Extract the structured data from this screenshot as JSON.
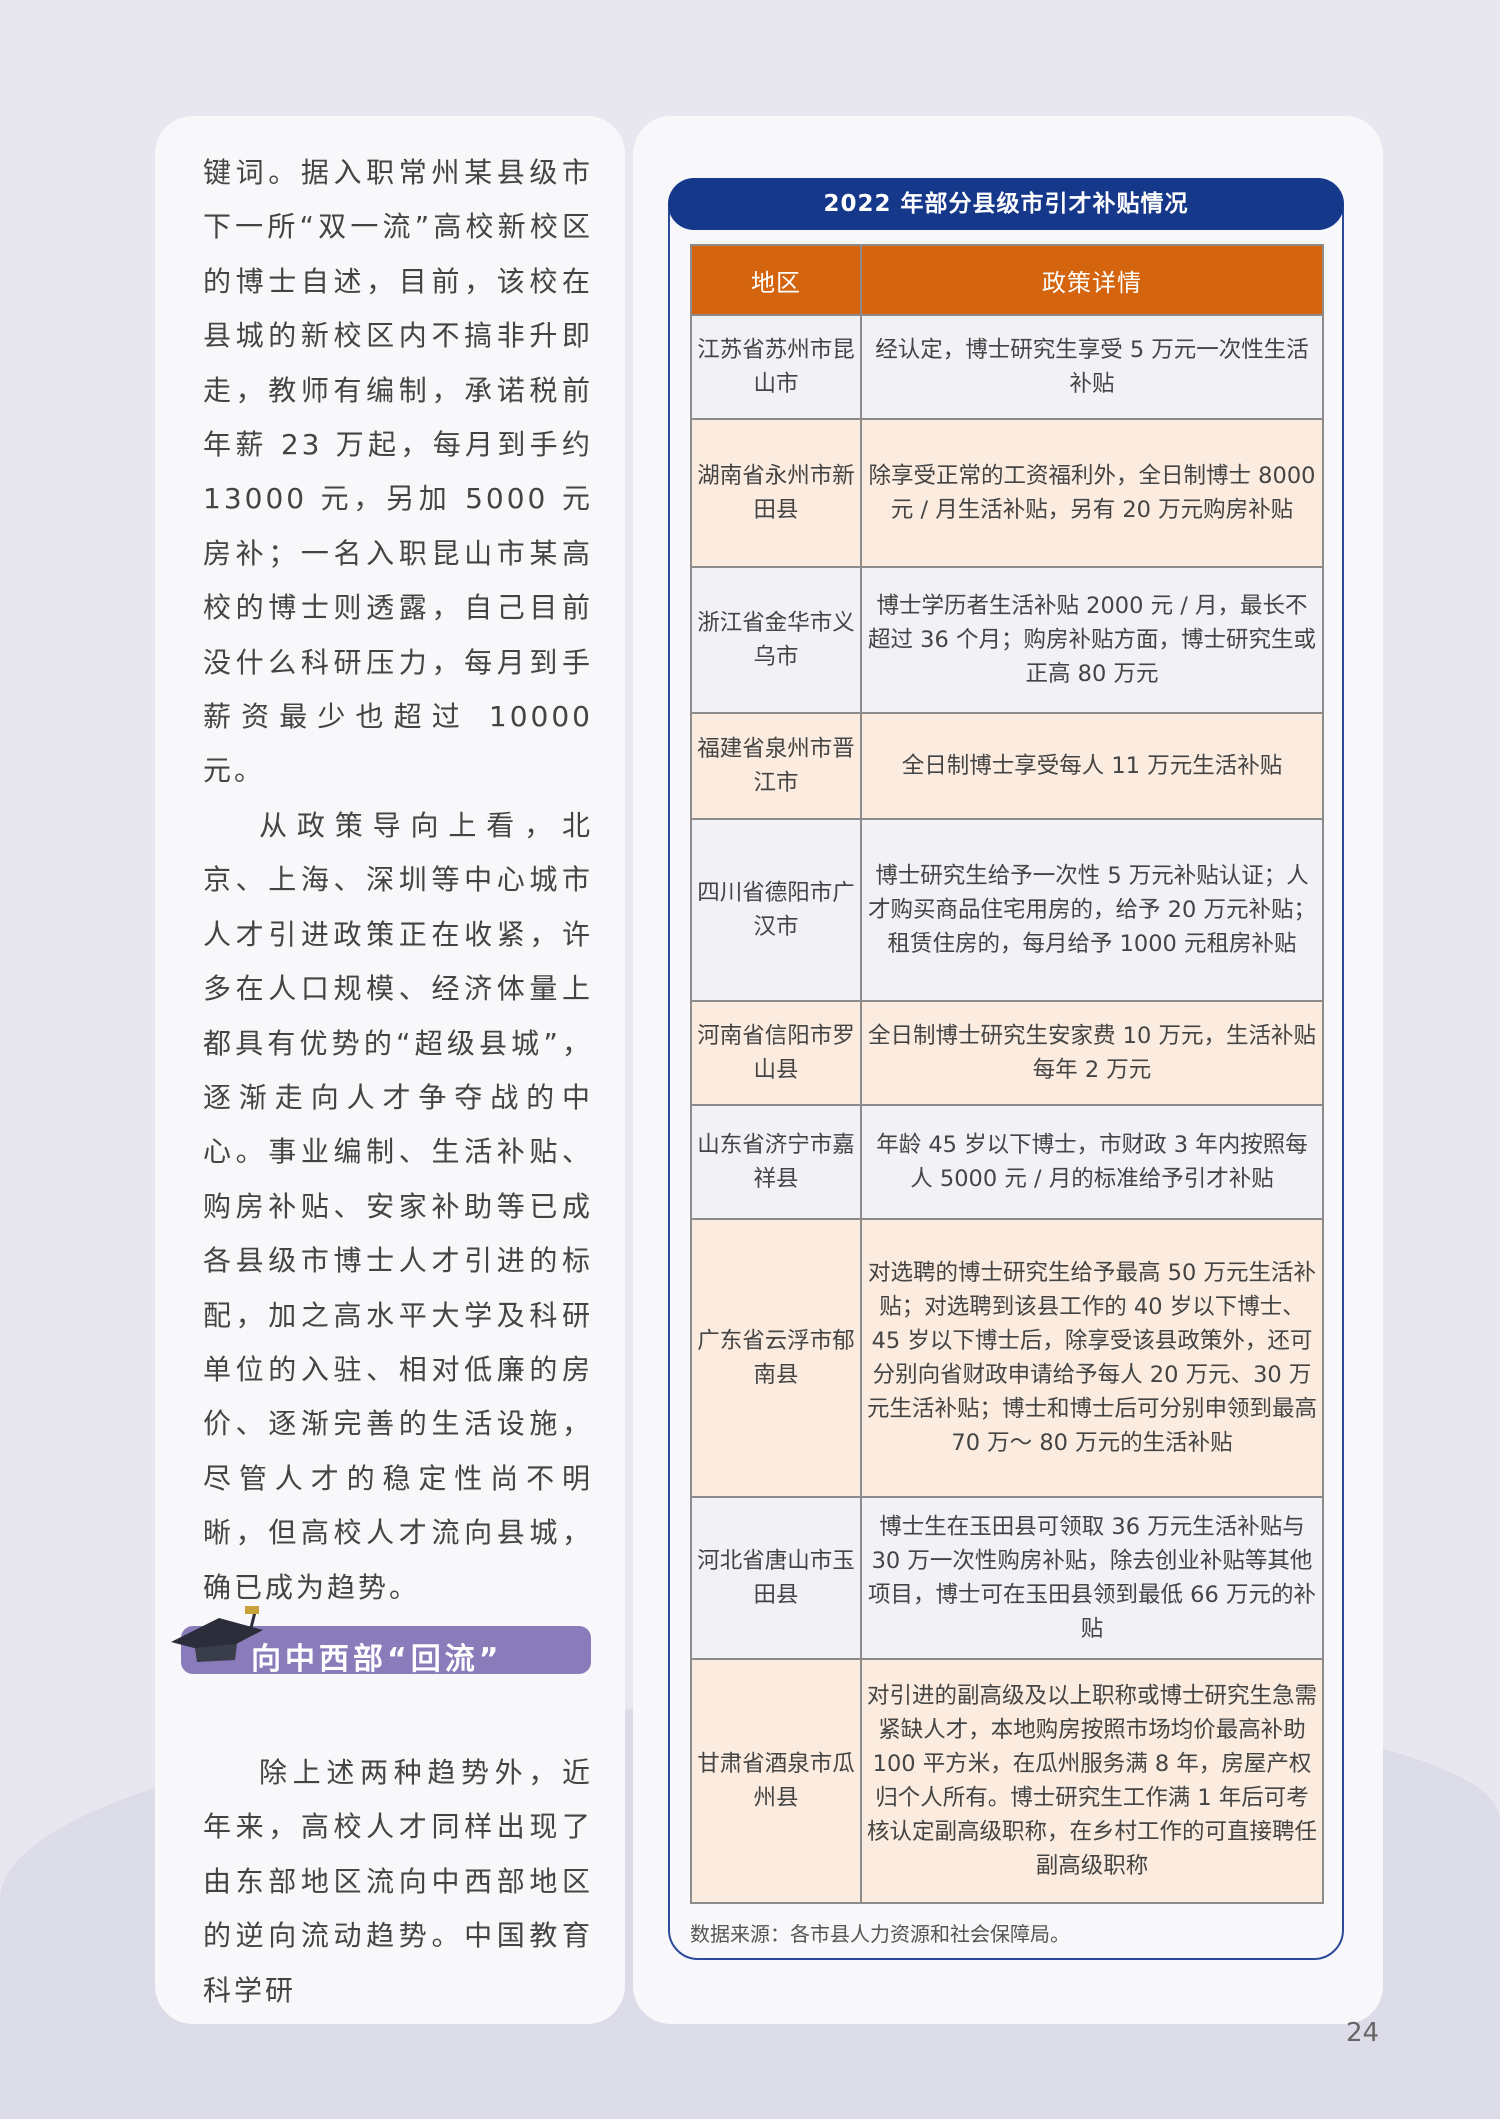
{
  "left_column": {
    "paragraph1": "键词。据入职常州某县级市下一所“双一流”高校新校区的博士自述，目前，该校在县城的新校区内不搞非升即走，教师有编制，承诺税前年薪 23 万起，每月到手约 13000 元，另加 5000 元房补；一名入职昆山市某高校的博士则透露，自己目前没什么科研压力，每月到手薪资最少也超过 10000 元。",
    "paragraph2": "从政策导向上看，北京、上海、深圳等中心城市人才引进政策正在收紧，许多在人口规模、经济体量上都具有优势的“超级县城”，逐渐走向人才争夺战的中心。事业编制、生活补贴、购房补贴、安家补助等已成各县级市博士人才引进的标配，加之高水平大学及科研单位的入驻、相对低廉的房价、逐渐完善的生活设施，尽管人才的稳定性尚不明晰，但高校人才流向县城，确已成为趋势。",
    "section_title": "向中西部“回流”",
    "paragraph3": "除上述两种趋势外，近年来，高校人才同样出现了由东部地区流向中西部地区的逆向流动趋势。中国教育科学研"
  },
  "table": {
    "title": "2022 年部分县级市引才补贴情况",
    "headers": [
      "地区",
      "政策详情"
    ],
    "rows": [
      {
        "region": "江苏省苏州市昆山市",
        "policy": "经认定，博士研究生享受 5 万元一次性生活补贴"
      },
      {
        "region": "湖南省永州市新田县",
        "policy": "除享受正常的工资福利外，全日制博士 8000 元 / 月生活补贴，另有 20 万元购房补贴"
      },
      {
        "region": "浙江省金华市义乌市",
        "policy": "博士学历者生活补贴 2000 元 / 月，最长不超过 36 个月；购房补贴方面，博士研究生或正高 80 万元"
      },
      {
        "region": "福建省泉州市晋江市",
        "policy": "全日制博士享受每人 11 万元生活补贴"
      },
      {
        "region": "四川省德阳市广汉市",
        "policy": "博士研究生给予一次性 5 万元补贴认证；人才购买商品住宅用房的，给予 20 万元补贴；租赁住房的，每月给予 1000 元租房补贴"
      },
      {
        "region": "河南省信阳市罗山县",
        "policy": "全日制博士研究生安家费 10 万元，生活补贴每年 2 万元"
      },
      {
        "region": "山东省济宁市嘉祥县",
        "policy": "年龄 45 岁以下博士，市财政 3 年内按照每人 5000 元 / 月的标准给予引才补贴"
      },
      {
        "region": "广东省云浮市郁南县",
        "policy": "对选聘的博士研究生给予最高 50 万元生活补贴；对选聘到该县工作的 40 岁以下博士、45 岁以下博士后，除享受该县政策外，还可分别向省财政申请给予每人 20 万元、30 万元生活补贴；博士和博士后可分别申领到最高 70 万～ 80 万元的生活补贴"
      },
      {
        "region": "河北省唐山市玉田县",
        "policy": "博士生在玉田县可领取 36 万元生活补贴与 30 万一次性购房补贴，除去创业补贴等其他项目，博士可在玉田县领到最低 66 万元的补贴"
      },
      {
        "region": "甘肃省酒泉市瓜州县",
        "policy": "对引进的副高级及以上职称或博士研究生急需紧缺人才，本地购房按照市场均价最高补助 100 平方米，在瓜州服务满 8 年，房屋产权归个人所有。博士研究生工作满 1 年后可考核认定副高级职称，在乡村工作的可直接聘任副高级职称"
      }
    ],
    "source": "数据来源：各市县人力资源和社会保障局。"
  },
  "page_number": "24",
  "colors": {
    "title_bar": "#16388a",
    "header_orange": "#d4650e",
    "row_peach": "#fbecdf",
    "section_purple": "#8a7bbb"
  }
}
